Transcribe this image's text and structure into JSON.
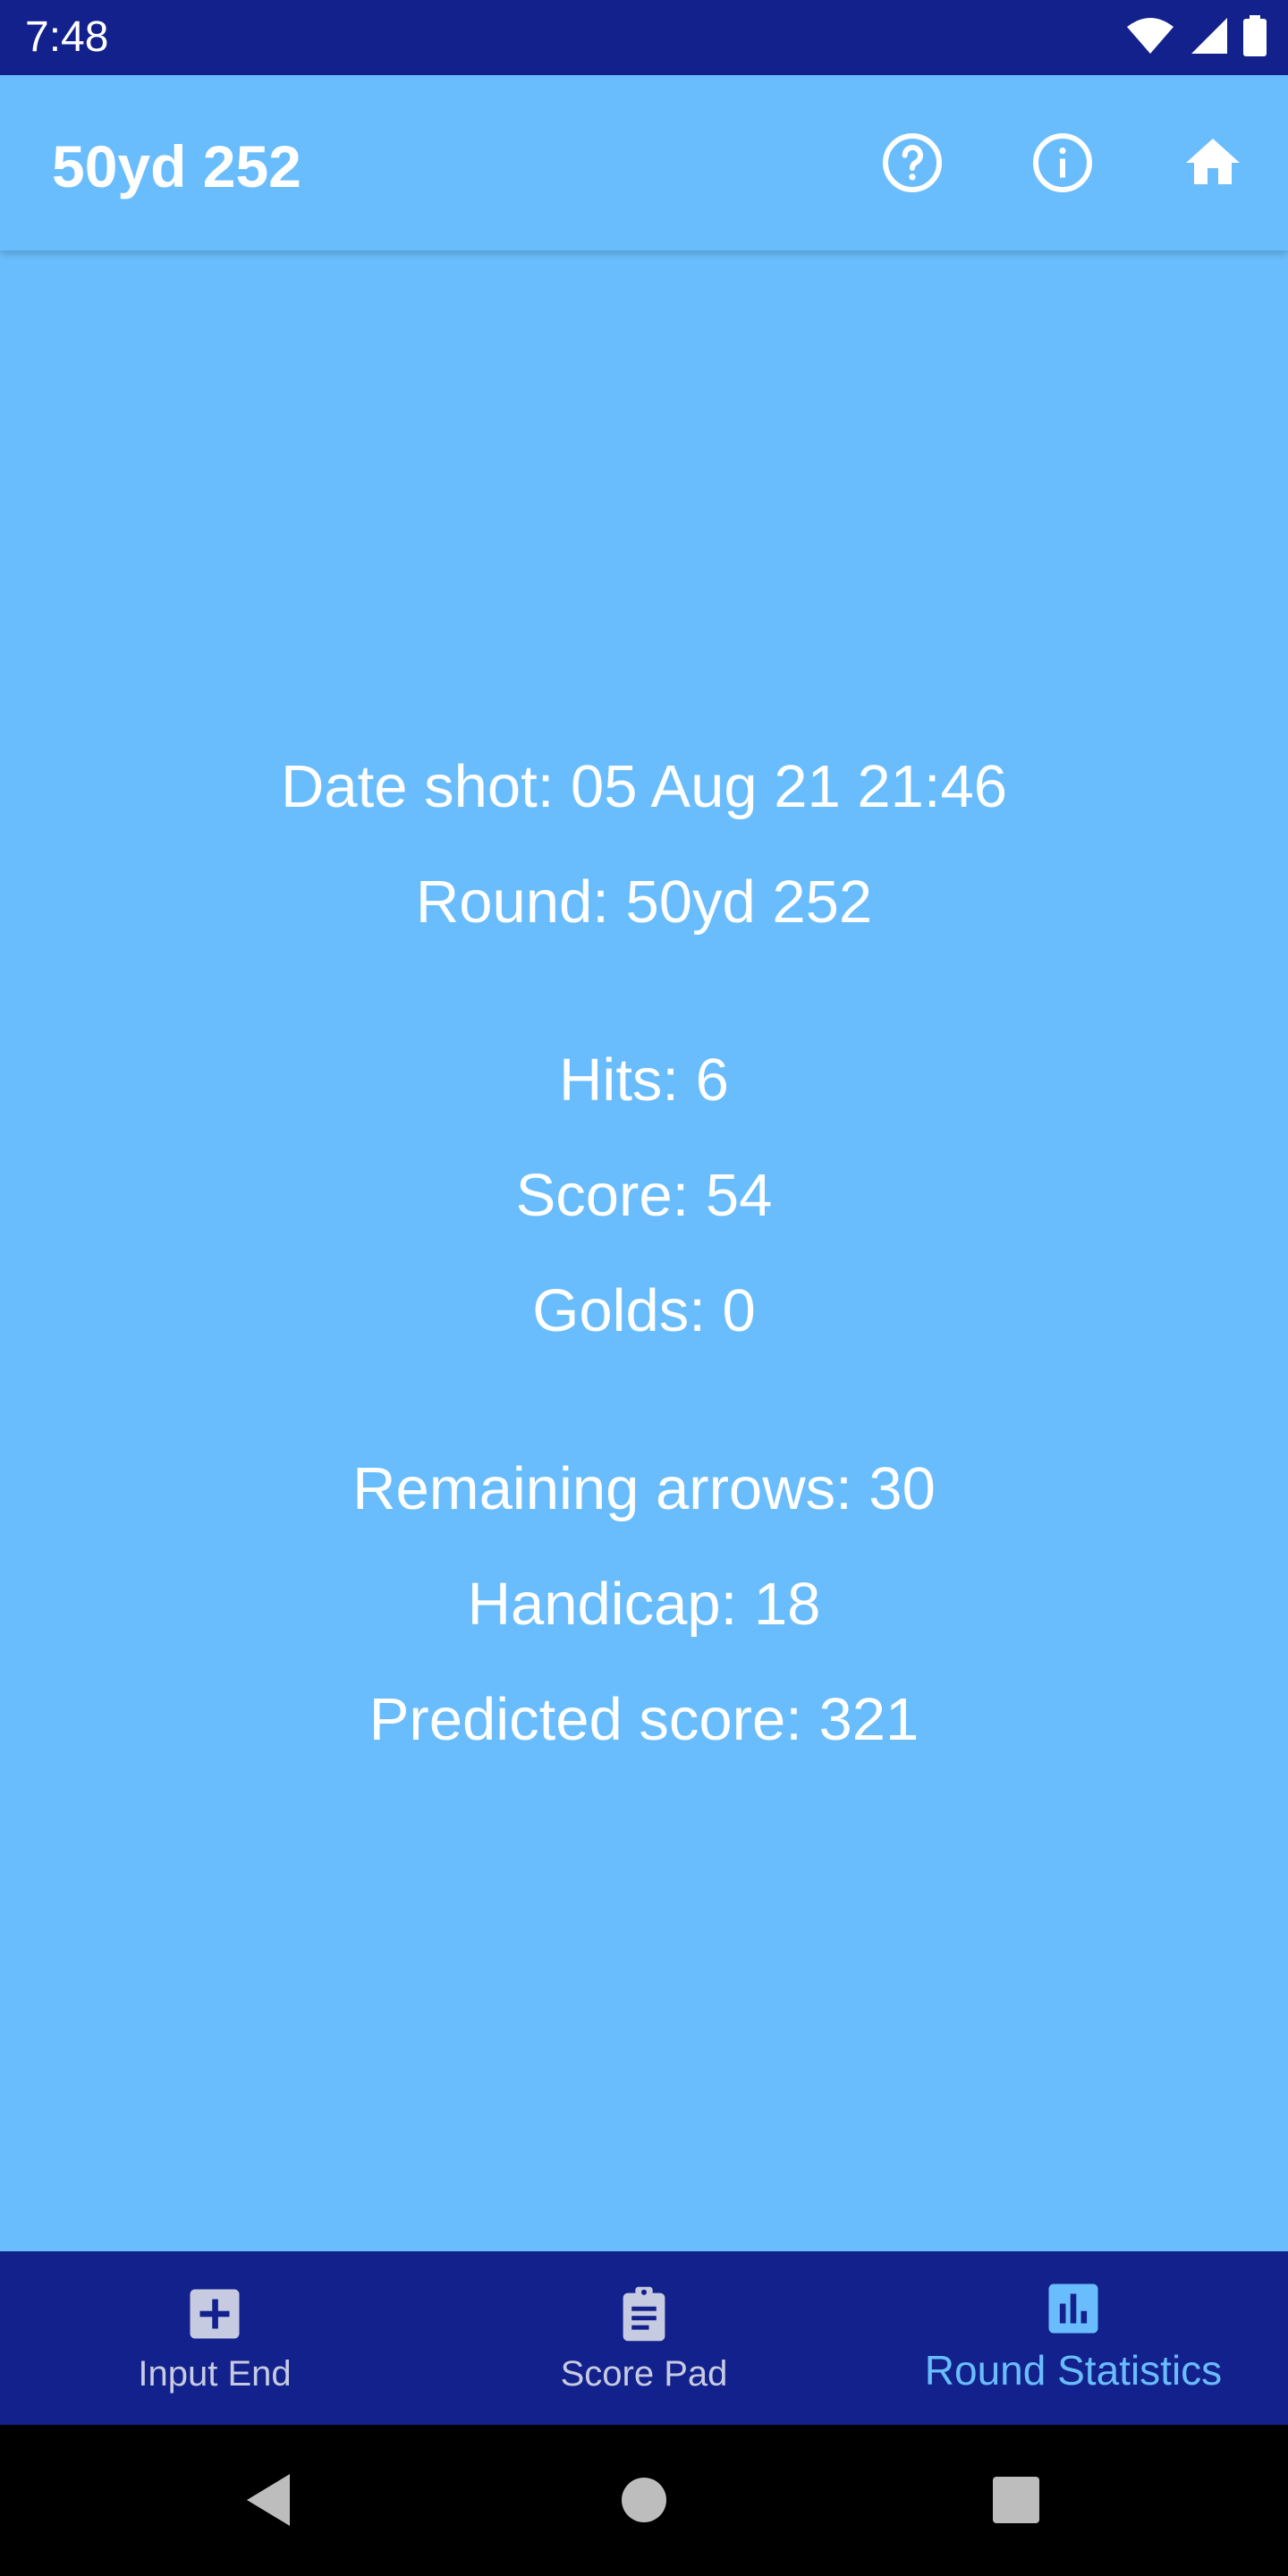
{
  "status_bar": {
    "time": "7:48"
  },
  "app_bar": {
    "title": "50yd 252",
    "actions": [
      {
        "icon": "help-circle-icon"
      },
      {
        "icon": "info-icon"
      },
      {
        "icon": "home-icon"
      }
    ]
  },
  "stats": {
    "date_shot": "Date shot: 05 Aug 21 21:46",
    "round": "Round: 50yd 252",
    "hits": "Hits: 6",
    "score": "Score: 54",
    "golds": "Golds: 0",
    "remaining_arrows": "Remaining arrows: 30",
    "handicap": "Handicap: 18",
    "predicted_score": "Predicted score: 321"
  },
  "bottom_nav": {
    "items": [
      {
        "label": "Input End",
        "icon": "add-box-icon",
        "active": false
      },
      {
        "label": "Score Pad",
        "icon": "clipboard-icon",
        "active": false
      },
      {
        "label": "Round Statistics",
        "icon": "bar-chart-icon",
        "active": true
      }
    ]
  },
  "colors": {
    "primary_dark": "#13218c",
    "background": "#6abdfc",
    "text": "#ffffff",
    "nav_inactive": "#c7cbe1",
    "nav_active": "#6abdfc"
  }
}
